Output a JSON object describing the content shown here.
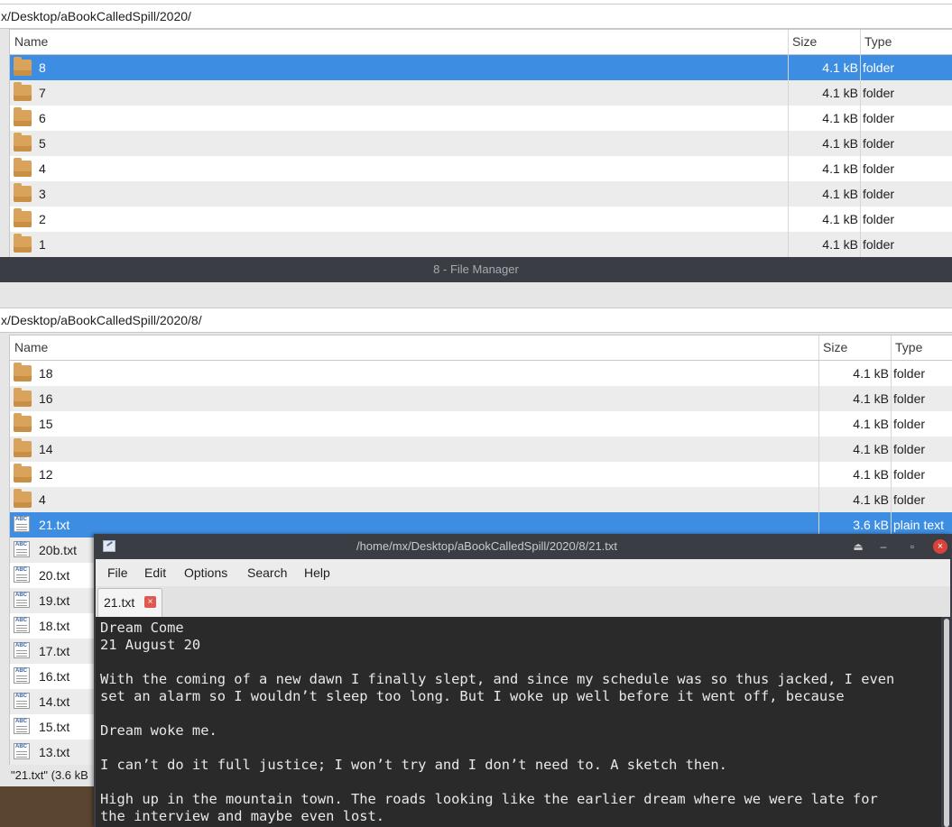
{
  "top_fm": {
    "path": "x/Desktop/aBookCalledSpill/2020/",
    "columns": {
      "name": "Name",
      "size": "Size",
      "type": "Type"
    },
    "rows": [
      {
        "name": "8",
        "size": "4.1 kB",
        "type": "folder",
        "icon": "folder-icon"
      },
      {
        "name": "7",
        "size": "4.1 kB",
        "type": "folder",
        "icon": "folder-icon"
      },
      {
        "name": "6",
        "size": "4.1 kB",
        "type": "folder",
        "icon": "folder-icon"
      },
      {
        "name": "5",
        "size": "4.1 kB",
        "type": "folder",
        "icon": "folder-icon"
      },
      {
        "name": "4",
        "size": "4.1 kB",
        "type": "folder",
        "icon": "folder-icon"
      },
      {
        "name": "3",
        "size": "4.1 kB",
        "type": "folder",
        "icon": "folder-icon"
      },
      {
        "name": "2",
        "size": "4.1 kB",
        "type": "folder",
        "icon": "folder-icon"
      },
      {
        "name": "1",
        "size": "4.1 kB",
        "type": "folder",
        "icon": "folder-icon"
      }
    ]
  },
  "window_title": "8 - File Manager",
  "bottom_fm": {
    "path": "x/Desktop/aBookCalledSpill/2020/8/",
    "columns": {
      "name": "Name",
      "size": "Size",
      "type": "Type"
    },
    "rows": [
      {
        "name": "18",
        "size": "4.1 kB",
        "type": "folder"
      },
      {
        "name": "16",
        "size": "4.1 kB",
        "type": "folder"
      },
      {
        "name": "15",
        "size": "4.1 kB",
        "type": "folder"
      },
      {
        "name": "14",
        "size": "4.1 kB",
        "type": "folder"
      },
      {
        "name": "12",
        "size": "4.1 kB",
        "type": "folder"
      },
      {
        "name": "4",
        "size": "4.1 kB",
        "type": "folder"
      },
      {
        "name": "21.txt",
        "size": "3.6 kB",
        "type": "plain text"
      },
      {
        "name": "20b.txt",
        "size": "",
        "type": ""
      },
      {
        "name": "20.txt",
        "size": "",
        "type": ""
      },
      {
        "name": "19.txt",
        "size": "",
        "type": ""
      },
      {
        "name": "18.txt",
        "size": "",
        "type": ""
      },
      {
        "name": "17.txt",
        "size": "",
        "type": ""
      },
      {
        "name": "16.txt",
        "size": "",
        "type": ""
      },
      {
        "name": "14.txt",
        "size": "",
        "type": ""
      },
      {
        "name": "15.txt",
        "size": "",
        "type": ""
      },
      {
        "name": "13.txt",
        "size": "",
        "type": ""
      }
    ],
    "status": "\"21.txt\" (3.6 kB"
  },
  "editor": {
    "title": "/home/mx/Desktop/aBookCalledSpill/2020/8/21.txt",
    "menu": {
      "file": "File",
      "edit": "Edit",
      "options": "Options",
      "search": "Search",
      "help": "Help"
    },
    "tab_label": "21.txt",
    "tab_close": "×",
    "controls": {
      "eject": "⏏",
      "minimize": "–",
      "restore": "▫",
      "close": "×"
    },
    "text": "Dream Come\n21 August 20\n\nWith the coming of a new dawn I finally slept, and since my schedule was so thus jacked, I even\nset an alarm so I wouldn’t sleep too long. But I woke up well before it went off, because\n\nDream woke me.\n\nI can’t do it full justice; I won’t try and I don’t need to. A sketch then.\n\nHigh up in the mountain town. The roads looking like the earlier dream where we were late for\nthe interview and maybe even lost."
  },
  "colors": {
    "selection": "#3d8ee3",
    "titlebar": "#3a3e44",
    "editor_bg": "#2a2a2a",
    "folder": "#d9a35b"
  }
}
